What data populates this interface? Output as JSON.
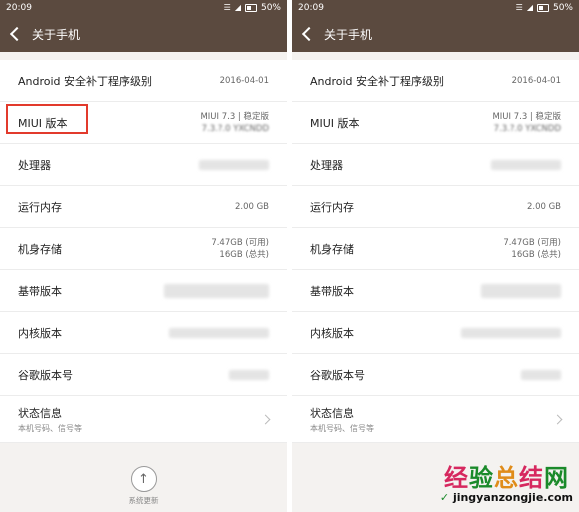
{
  "status": {
    "time": "20:09",
    "battery": "50%"
  },
  "title": "关于手机",
  "rows": [
    {
      "label": "Android 安全补丁程序级别",
      "value": "2016-04-01"
    },
    {
      "label": "MIUI 版本",
      "value1": "MIUI 7.3 | 稳定版",
      "value2": "7.3.?.0 YXCNDD"
    },
    {
      "label": "处理器"
    },
    {
      "label": "运行内存",
      "value": "2.00 GB"
    },
    {
      "label": "机身存储",
      "value1": "7.47GB (可用)",
      "value2": "16GB (总共)"
    },
    {
      "label": "基带版本"
    },
    {
      "label": "内核版本"
    },
    {
      "label": "谷歌版本号"
    },
    {
      "label": "状态信息",
      "sub": "本机号码、信号等"
    }
  ],
  "system_update": "系统更新",
  "watermark": {
    "main": "经验总结网",
    "sub": "jingyanzongjie.com"
  }
}
